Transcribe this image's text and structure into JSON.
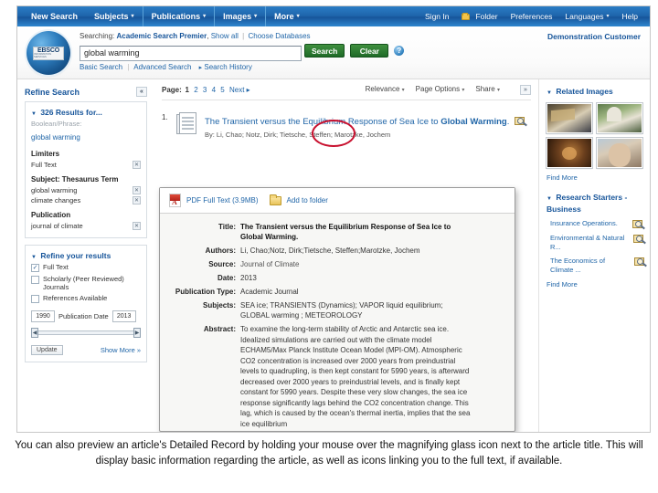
{
  "topnav": {
    "left_items": [
      {
        "label": "New Search",
        "caret": false
      },
      {
        "label": "Subjects",
        "caret": true
      },
      {
        "label": "Publications",
        "caret": true
      },
      {
        "label": "Images",
        "caret": true
      },
      {
        "label": "More",
        "caret": true
      }
    ],
    "right_items": [
      {
        "label": "Sign In",
        "icon": ""
      },
      {
        "label": "Folder",
        "icon": "folder-icon"
      },
      {
        "label": "Preferences",
        "icon": ""
      },
      {
        "label": "Languages",
        "icon": "chevron-down-icon"
      },
      {
        "label": "Help",
        "icon": ""
      }
    ]
  },
  "brand": {
    "name": "EBSCO",
    "tagline": "INFORMATION SERVICES"
  },
  "search": {
    "searching_label": "Searching:",
    "database": "Academic Search Premier",
    "show_all": "Show all",
    "choose_databases": "Choose Databases",
    "query": "global warming",
    "placeholder": "",
    "search_button": "Search",
    "clear_button": "Clear",
    "help_icon": "?",
    "basic_search": "Basic Search",
    "advanced_search": "Advanced Search",
    "search_history": "Search History",
    "customer": "Demonstration Customer"
  },
  "refine": {
    "panel_title": "Refine Search",
    "collapse_icon": "«",
    "results_heading": "326 Results for...",
    "boolean_label": "Boolean/Phrase:",
    "boolean_value": "global warming",
    "limiters_heading": "Limiters",
    "limiters": [
      {
        "label": "Full Text",
        "remove": "✕"
      }
    ],
    "subject_heading": "Subject: Thesaurus Term",
    "subjects": [
      {
        "label": "global warming",
        "remove": "✕"
      },
      {
        "label": "climate changes",
        "remove": "✕"
      }
    ],
    "publication_heading": "Publication",
    "publications": [
      {
        "label": "journal of climate",
        "remove": "✕"
      }
    ],
    "refine_heading": "Refine your results",
    "checkboxes": [
      {
        "label": "Full Text",
        "checked": true
      },
      {
        "label": "Scholarly (Peer Reviewed) Journals",
        "checked": false
      },
      {
        "label": "References Available",
        "checked": false
      }
    ],
    "date_from": "1990",
    "date_to": "2013",
    "date_label": "Publication Date",
    "update_button": "Update",
    "show_more": "Show More »"
  },
  "results": {
    "page_label": "Page:",
    "pages": [
      "1",
      "2",
      "3",
      "4",
      "5"
    ],
    "next": "Next ▸",
    "sort": "Relevance",
    "page_options": "Page Options",
    "share": "Share",
    "expand_icon": "»",
    "items": [
      {
        "number": "1.",
        "title_plain": "The Transient versus the Equilibrium Response of Sea Ice to ",
        "title_bold": "Global Warming",
        "title_end": ".",
        "magnify_icon": "magnifying-glass-icon",
        "authors_line": "By: Li, Chao; Notz, Dirk; Tietsche, Steffen; Marotzke, Jochem"
      }
    ]
  },
  "preview": {
    "pdf_label": "PDF Full Text (3.9MB)",
    "add_to_folder": "Add to folder",
    "fields": [
      {
        "label": "Title:",
        "value": "The Transient versus the Equilibrium Response of Sea Ice to Global Warming.",
        "style": "title"
      },
      {
        "label": "Authors:",
        "value": "Li, Chao;Notz, Dirk;Tietsche, Steffen;Marotzke, Jochem",
        "style": "normal"
      },
      {
        "label": "Source:",
        "value": "Journal of Climate",
        "style": "muted"
      },
      {
        "label": "Date:",
        "value": "2013",
        "style": "normal"
      },
      {
        "label": "Publication Type:",
        "value": "Academic Journal",
        "style": "normal"
      },
      {
        "label": "Subjects:",
        "value": "SEA ice; TRANSIENTS (Dynamics); VAPOR liquid equilibrium; GLOBAL warming ; METEOROLOGY",
        "style": "normal"
      },
      {
        "label": "Abstract:",
        "value": "To examine the long-term stability of Arctic and Antarctic sea ice. Idealized simulations are carried out with the climate model ECHAM5/Max Planck Institute Ocean Model (MPI-OM). Atmospheric CO2 concentration is increased over 2000 years from preindustrial levels to quadrupling, is then kept constant for 5990 years, is afterward decreased over 2000 years to preindustrial levels, and is finally kept constant for 5990 years. Despite these very slow changes, the sea ice response significantly lags behind the CO2 concentration change. This lag, which is caused by the ocean's thermal inertia, implies that the sea ice equilibrium",
        "style": "abs"
      }
    ]
  },
  "related": {
    "images_heading": "Related Images",
    "images": [
      {
        "name": "thumbnail-protest"
      },
      {
        "name": "thumbnail-capitol"
      },
      {
        "name": "thumbnail-crowd"
      },
      {
        "name": "thumbnail-portrait"
      }
    ],
    "find_more": "Find More",
    "starters_heading": "Research Starters - Business",
    "starters": [
      {
        "label": "Insurance Operations.",
        "icon": "magnifying-glass-icon"
      },
      {
        "label": "Environmental & Natural R...",
        "icon": "magnifying-glass-icon"
      },
      {
        "label": "The Economics of Climate ...",
        "icon": "magnifying-glass-icon"
      }
    ],
    "starters_find_more": "Find More"
  },
  "caption": {
    "text": "You can also preview an article's Detailed Record by holding your mouse over the magnifying glass icon next to the article title. This will display basic information regarding the article, as well as icons linking you to the full text, if available."
  },
  "colors": {
    "nav_blue": "#1f66ad",
    "link_blue": "#2166a8",
    "heading_blue": "#17559a",
    "button_green": "#1f6b28",
    "annotation_red": "#c8102e"
  }
}
